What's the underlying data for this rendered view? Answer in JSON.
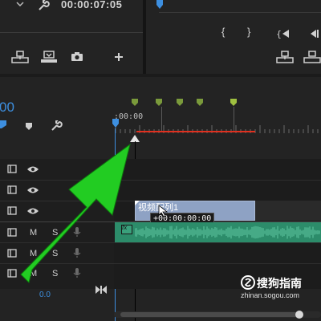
{
  "source_monitor": {
    "timecode": "00:00:07:05"
  },
  "timeline": {
    "timecode_fragment": "00",
    "ruler_start": ":00:00",
    "clip_name": "视频 序列 1",
    "clip_name_obscured": "视频配列1",
    "drag_tooltip": "+00:00:00:00",
    "audio_level": "0.0",
    "video_tracks": [
      "",
      "",
      ""
    ],
    "audio_tracks": [
      {
        "m": "M",
        "s": "S"
      },
      {
        "m": "M",
        "s": "S"
      },
      {
        "m": "M",
        "s": "S"
      }
    ],
    "audio_clip_badge": "fx"
  },
  "watermark": {
    "brand": "搜狗指南",
    "url": "zhinan.sogou.com"
  },
  "colors": {
    "accent_blue": "#3d8fe0",
    "work_area_red": "#e0301f",
    "marker_green": "#7a9a3b",
    "video_clip": "#8ea2c4",
    "audio_clip": "#2c8c6a",
    "annotation_arrow": "#22cc22"
  }
}
